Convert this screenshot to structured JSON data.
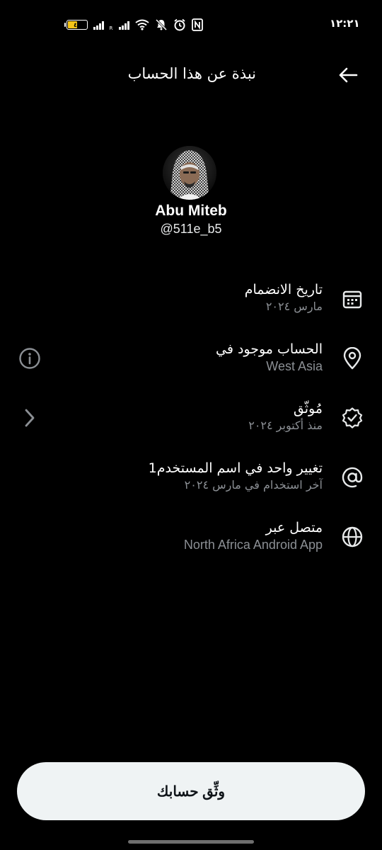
{
  "status_bar": {
    "time": "١٢:٢١",
    "battery_level": "٤٦",
    "battery_fraction": 0.46,
    "network_roaming_label": "R",
    "icons": [
      "battery-icon",
      "signal-icon",
      "roaming-signal-icon",
      "wifi-icon",
      "mute-icon",
      "alarm-icon",
      "nfc-icon"
    ]
  },
  "header": {
    "title": "نبذة عن هذا الحساب",
    "back_icon": "arrow-left-icon"
  },
  "profile": {
    "display_name": "Abu Miteb",
    "handle": "@511e_b5"
  },
  "info_rows": [
    {
      "icon": "calendar-icon",
      "title": "تاريخ الانضمام",
      "subtitle": "مارس ٢٠٢٤"
    },
    {
      "icon": "location-pin-icon",
      "title": "الحساب موجود في",
      "subtitle": "West Asia",
      "side_icon": "info-circle-icon"
    },
    {
      "icon": "verified-badge-icon",
      "title": "مُوثّق",
      "subtitle": "منذ أكتوبر ٢٠٢٤",
      "side_icon": "chevron-right-icon"
    },
    {
      "icon": "at-sign-icon",
      "title": "تغيير واحد في اسم المستخدم1",
      "subtitle": "آخر استخدام في مارس ٢٠٢٤"
    },
    {
      "icon": "globe-icon",
      "title": "متصل عبر",
      "subtitle": "North Africa Android App"
    }
  ],
  "verify_button": {
    "label": "وثِّق حسابك"
  },
  "colors": {
    "background": "#000000",
    "primary_text": "#ffffff",
    "secondary_text": "#8b8f94",
    "button_background": "#eff3f4",
    "button_text": "#0f1419",
    "battery_fill": "#f5c518"
  }
}
